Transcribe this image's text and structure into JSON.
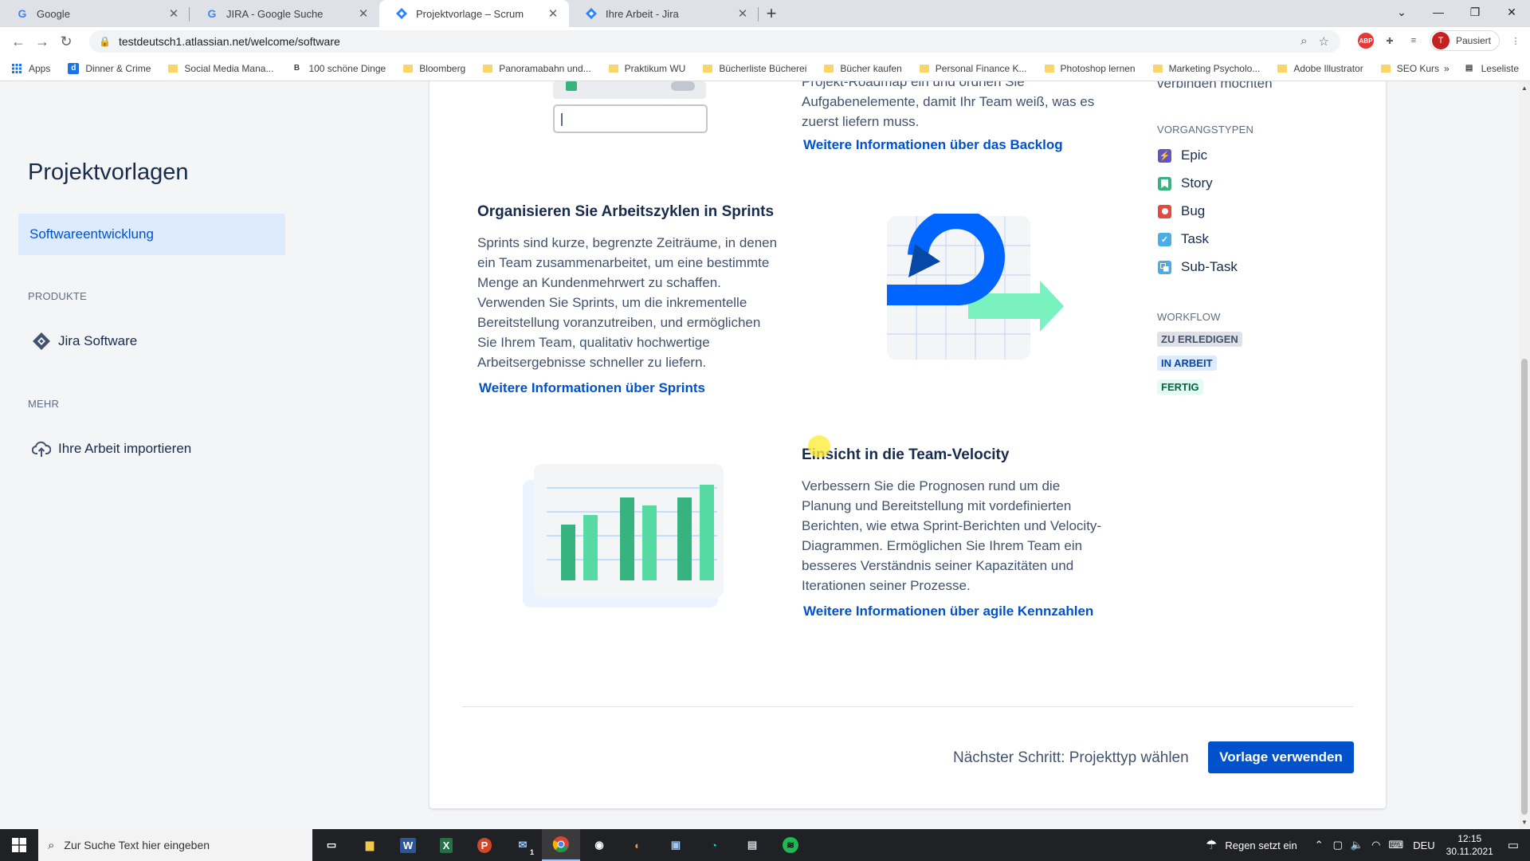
{
  "browser": {
    "tabs": [
      {
        "title": "Google",
        "favicon": "G",
        "active": false
      },
      {
        "title": "JIRA - Google Suche",
        "favicon": "G",
        "active": false
      },
      {
        "title": "Projektvorlage – Scrum",
        "favicon": "jira-icon",
        "active": true
      },
      {
        "title": "Ihre Arbeit - Jira",
        "favicon": "jira-icon",
        "active": false
      }
    ],
    "url": "testdeutsch1.atlassian.net/welcome/software",
    "profile_label": "Pausiert",
    "profile_initial": "T",
    "bookmarks": [
      {
        "label": "Apps",
        "type": "apps"
      },
      {
        "label": "Dinner & Crime",
        "type": "site"
      },
      {
        "label": "Social Media Mana...",
        "type": "folder"
      },
      {
        "label": "100 schöne Dinge",
        "type": "site"
      },
      {
        "label": "Bloomberg",
        "type": "folder"
      },
      {
        "label": "Panoramabahn und...",
        "type": "folder"
      },
      {
        "label": "Praktikum WU",
        "type": "folder"
      },
      {
        "label": "Bücherliste Bücherei",
        "type": "folder"
      },
      {
        "label": "Bücher kaufen",
        "type": "folder"
      },
      {
        "label": "Personal Finance K...",
        "type": "folder"
      },
      {
        "label": "Photoshop lernen",
        "type": "folder"
      },
      {
        "label": "Marketing Psycholo...",
        "type": "folder"
      },
      {
        "label": "Adobe Illustrator",
        "type": "folder"
      },
      {
        "label": "SEO Kurs",
        "type": "folder"
      }
    ],
    "reading_list": "Leseliste"
  },
  "sidebar": {
    "title": "Projektvorlagen",
    "active_item": "Softwareentwicklung",
    "section_products": "PRODUKTE",
    "product_item": "Jira Software",
    "section_more": "MEHR",
    "import_item": "Ihre Arbeit importieren"
  },
  "content": {
    "top_text_line1": "Projekt-Roadmap ein und ordnen Sie",
    "top_text_line2": "Aufgabenelemente, damit Ihr Team weiß, was es",
    "top_text_line3": "zuerst liefern muss.",
    "backlog_link": "Weitere Informationen über das Backlog",
    "sprints_heading": "Organisieren Sie Arbeitszyklen in Sprints",
    "sprints_lines": [
      "Sprints sind kurze, begrenzte Zeiträume, in denen",
      "ein Team zusammenarbeitet, um eine bestimmte",
      "Menge an Kundenmehrwert zu schaffen.",
      "Verwenden Sie Sprints, um die inkrementelle",
      "Bereitstellung voranzutreiben, und ermöglichen",
      "Sie Ihrem Team, qualitativ hochwertige",
      "Arbeitsergebnisse schneller zu liefern."
    ],
    "sprints_link": "Weitere Informationen über Sprints",
    "velocity_heading": "Einsicht in die Team-Velocity",
    "velocity_lines": [
      "Verbessern Sie die Prognosen rund um die",
      "Planung und Bereitstellung mit vordefinierten",
      "Berichten, wie etwa Sprint-Berichten und Velocity-",
      "Diagrammen. Ermöglichen Sie Ihrem Team ein",
      "besseres Verständnis seiner Kapazitäten und",
      "Iterationen seiner Prozesse."
    ],
    "velocity_link": "Weitere Informationen über agile Kennzahlen"
  },
  "right_col": {
    "top_text": "verbinden möchten",
    "issue_types_heading": "VORGANGSTYPEN",
    "issue_types": [
      {
        "label": "Epic",
        "color": "#6554c0",
        "icon": "epic-icon"
      },
      {
        "label": "Story",
        "color": "#36b37e",
        "icon": "story-icon"
      },
      {
        "label": "Bug",
        "color": "#e5493a",
        "icon": "bug-icon"
      },
      {
        "label": "Task",
        "color": "#4bade8",
        "icon": "task-icon"
      },
      {
        "label": "Sub-Task",
        "color": "#4bade8",
        "icon": "subtask-icon"
      }
    ],
    "workflow_heading": "WORKFLOW",
    "workflow": [
      {
        "label": "ZU ERLEDIGEN",
        "bg": "#dfe1e6",
        "fg": "#42526e"
      },
      {
        "label": "IN ARBEIT",
        "bg": "#deebff",
        "fg": "#0747a6"
      },
      {
        "label": "FERTIG",
        "bg": "#e3fcef",
        "fg": "#006644"
      }
    ]
  },
  "footer": {
    "next_step": "Nächster Schritt: Projekttyp wählen",
    "cta": "Vorlage verwenden"
  },
  "taskbar": {
    "search_placeholder": "Zur Suche Text hier eingeben",
    "weather": "Regen setzt ein",
    "lang": "DEU",
    "time": "12:15",
    "date": "30.11.2021",
    "mail_badge": "1"
  }
}
